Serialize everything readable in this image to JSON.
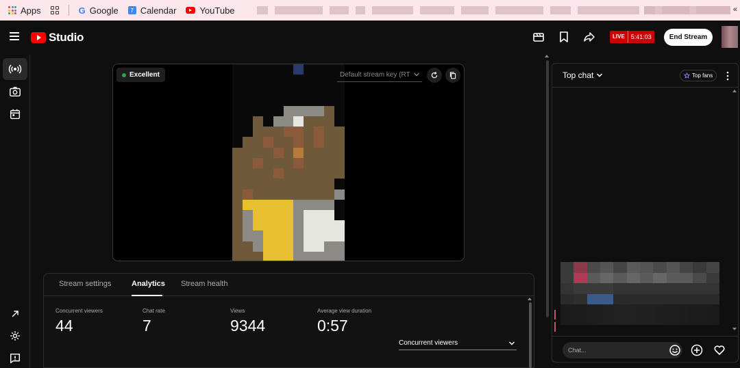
{
  "bookmarks": {
    "items": [
      {
        "label": "Apps",
        "icon": "apps-grid-icon"
      },
      {
        "label": "Google",
        "icon": "google-icon"
      },
      {
        "label": "Calendar",
        "icon": "calendar-icon",
        "badge": "7"
      },
      {
        "label": "YouTube",
        "icon": "youtube-icon"
      }
    ],
    "more": "«"
  },
  "header": {
    "app_name": "Studio",
    "live_label": "LIVE",
    "live_time": "5:41:03",
    "end_stream_label": "End Stream"
  },
  "preview": {
    "quality_label": "Excellent",
    "stream_key_label": "Default stream key (RT"
  },
  "tabs": [
    {
      "label": "Stream settings"
    },
    {
      "label": "Analytics",
      "active": true
    },
    {
      "label": "Stream health"
    }
  ],
  "metrics": [
    {
      "label": "Concurrent viewers",
      "value": "44"
    },
    {
      "label": "Chat rate",
      "value": "7"
    },
    {
      "label": "Views",
      "value": "9344"
    },
    {
      "label": "Average view duration",
      "value": "0:57"
    }
  ],
  "metric_selector": {
    "value": "Concurrent viewers"
  },
  "chat": {
    "title": "Top chat",
    "top_fans_label": "Top fans",
    "input_placeholder": "Chat..."
  },
  "colors": {
    "live_red": "#cc0000",
    "status_green": "#2ba640",
    "youtube_red": "#ff0000"
  }
}
